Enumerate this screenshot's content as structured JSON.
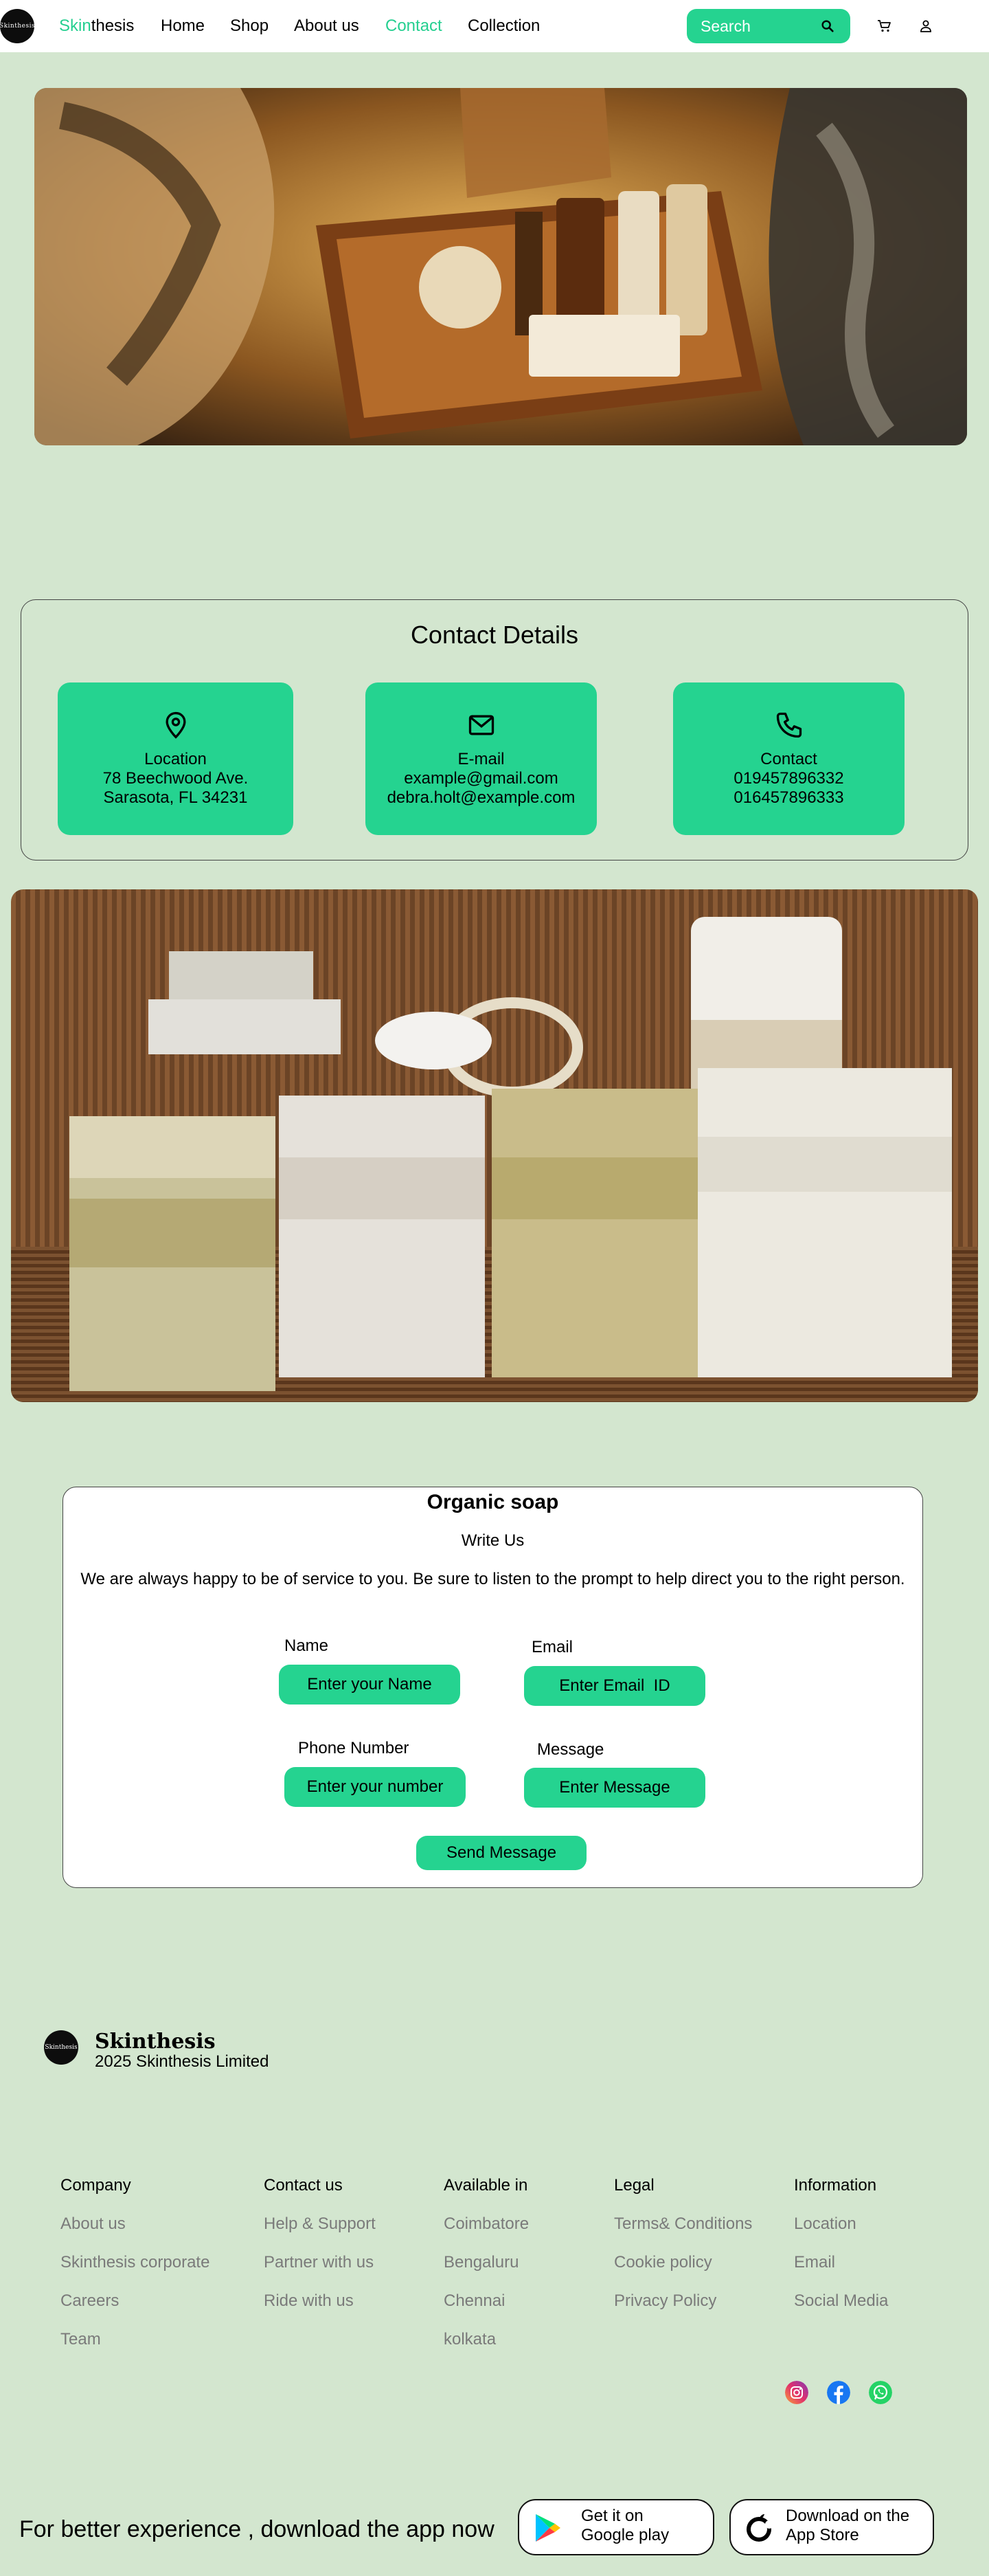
{
  "nav": {
    "brand_accent": "Skin",
    "brand_rest": "thesis",
    "logo_text": "Skinthesis",
    "links": [
      "Home",
      "Shop",
      "About us",
      "Contact",
      "Collection"
    ],
    "active": "Contact",
    "search_placeholder": "Search"
  },
  "contact": {
    "title": "Contact Details",
    "location": {
      "label": "Location",
      "line1": "78 Beechwood Ave.",
      "line2": "Sarasota, FL 34231"
    },
    "email": {
      "label": "E-mail",
      "line1": "example@gmail.com",
      "line2": "debra.holt@example.com"
    },
    "phone": {
      "label": "Contact",
      "line1": "019457896332",
      "line2": "016457896333"
    }
  },
  "form": {
    "title": "Organic soap",
    "subtitle": "Write Us",
    "description": "We are always happy to be of service to you. Be sure to listen to the prompt to help direct you to the right person.",
    "name_label": "Name",
    "name_placeholder": "Enter your Name",
    "email_label": "Email",
    "email_placeholder": "Enter Email  ID",
    "phone_label": "Phone Number",
    "phone_placeholder": "Enter your number",
    "message_label": "Message",
    "message_placeholder": "Enter Message",
    "send_label": "Send Message"
  },
  "footer": {
    "brand": "Skinthesis",
    "copyright": "2025 Skinthesis Limited",
    "columns": [
      {
        "heading": "Company",
        "links": [
          "About us",
          "Skinthesis corporate",
          "Careers",
          "Team"
        ]
      },
      {
        "heading": "Contact us",
        "links": [
          "Help & Support",
          "Partner with us",
          "Ride with us"
        ]
      },
      {
        "heading": "Available in",
        "links": [
          "Coimbatore",
          "Bengaluru",
          "Chennai",
          "kolkata"
        ]
      },
      {
        "heading": "Legal",
        "links": [
          "Terms& Conditions",
          "Cookie policy",
          "Privacy Policy"
        ]
      },
      {
        "heading": "Information",
        "links": [
          "Location",
          "Email",
          "Social Media"
        ]
      }
    ],
    "social_icons": [
      "instagram-icon",
      "facebook-icon",
      "whatsapp-icon"
    ],
    "download_text": "For better experience , download the app now",
    "google_play": {
      "small": "Get it on",
      "big": "Google play"
    },
    "app_store": {
      "small": "Download on the",
      "big": "App Store"
    }
  },
  "colors": {
    "background": "#d3e6cf",
    "accent": "#25d390",
    "accent_text": "#25cf90"
  }
}
